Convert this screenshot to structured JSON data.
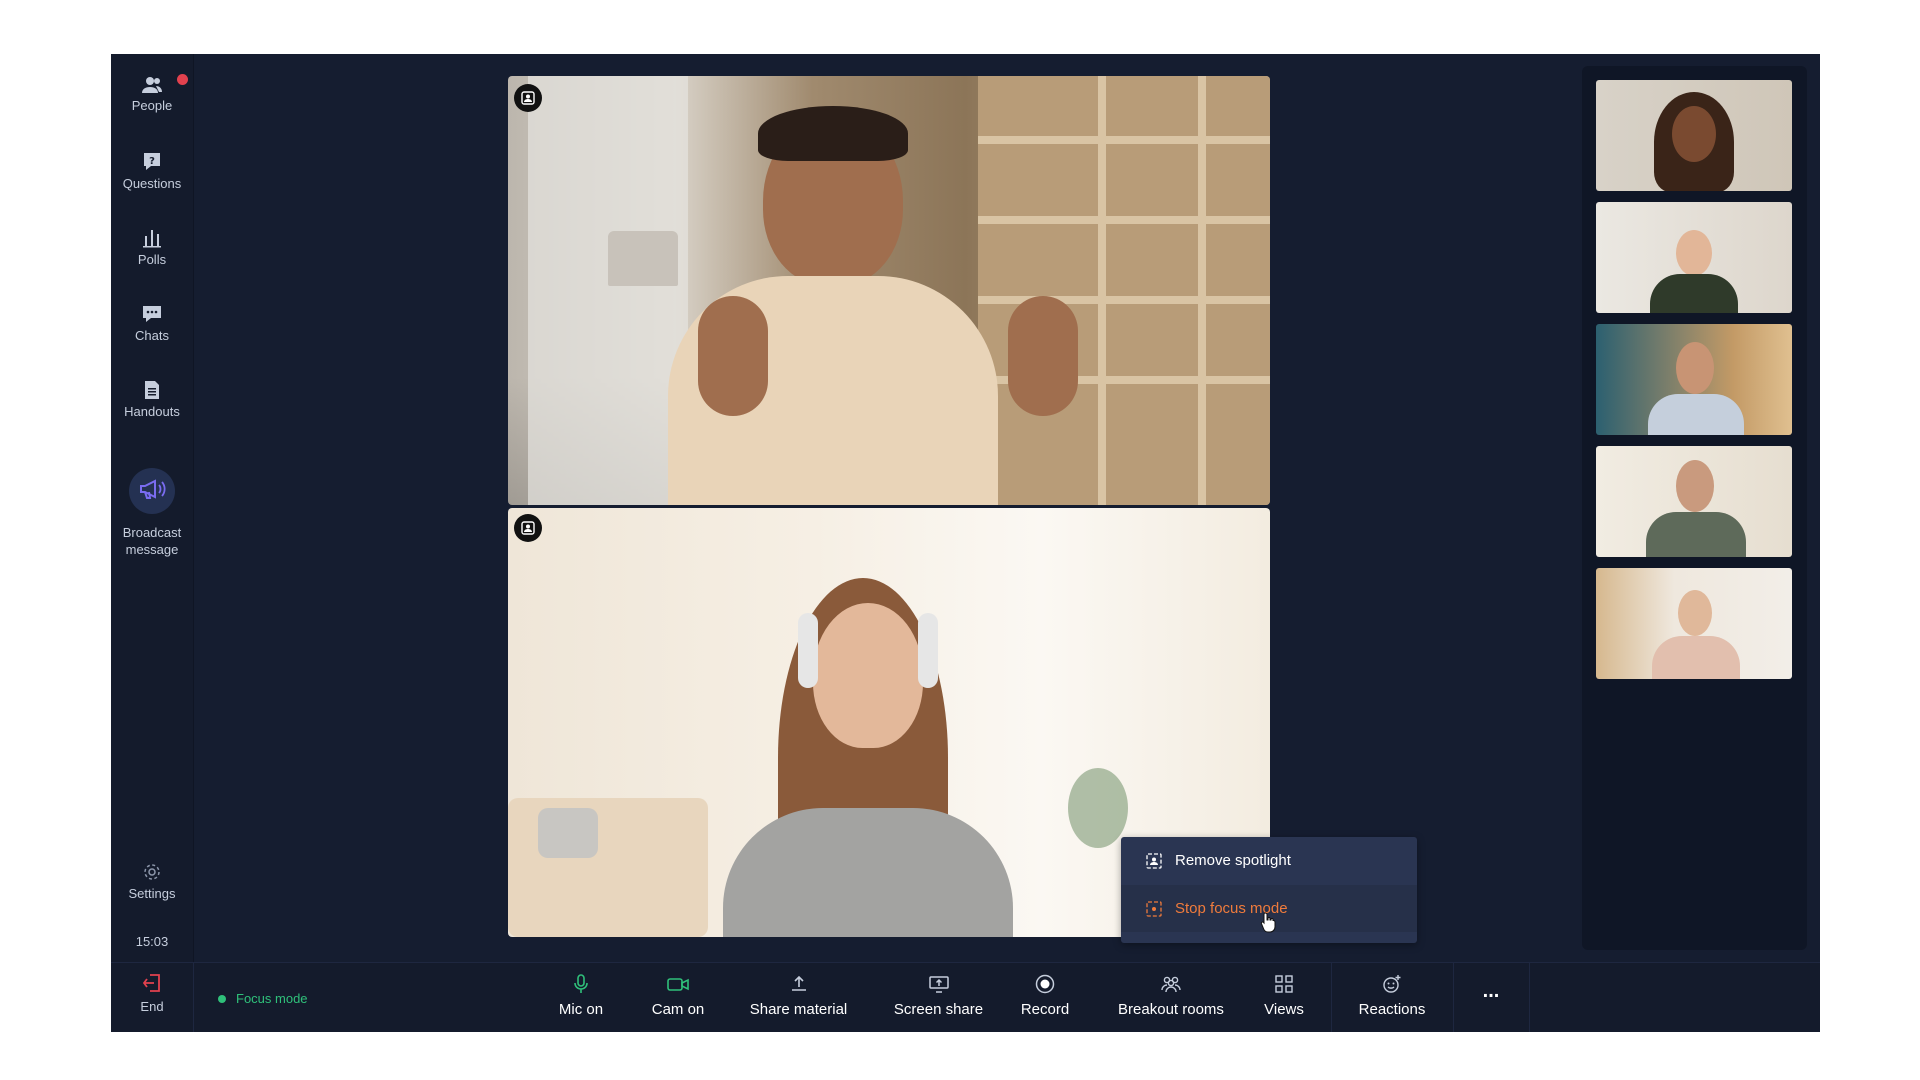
{
  "sidebar": {
    "items": [
      {
        "label": "People",
        "icon": "people-icon"
      },
      {
        "label": "Questions",
        "icon": "question-icon"
      },
      {
        "label": "Polls",
        "icon": "poll-icon"
      },
      {
        "label": "Chats",
        "icon": "chat-icon"
      },
      {
        "label": "Handouts",
        "icon": "document-icon"
      }
    ],
    "broadcast_label": "Broadcast message",
    "settings_label": "Settings",
    "clock": "15:03"
  },
  "menu": {
    "remove_spotlight": "Remove spotlight",
    "stop_focus_mode": "Stop focus mode"
  },
  "bottombar": {
    "end_label": "End",
    "focus_mode": "Focus mode",
    "buttons": [
      {
        "label": "Mic on",
        "icon": "mic-icon"
      },
      {
        "label": "Cam on",
        "icon": "camera-icon"
      },
      {
        "label": "Share material",
        "icon": "share-icon"
      },
      {
        "label": "Screen share",
        "icon": "screen-share-icon"
      },
      {
        "label": "Record",
        "icon": "record-icon"
      },
      {
        "label": "Breakout rooms",
        "icon": "breakout-icon"
      },
      {
        "label": "Views",
        "icon": "grid-icon"
      },
      {
        "label": "Reactions",
        "icon": "reactions-icon"
      }
    ],
    "more_label": "..."
  },
  "colors": {
    "background": "#151d30",
    "accent_green": "#2fc07a",
    "accent_orange": "#ef7b3c",
    "end_red": "#e2414e",
    "broadcast_purple": "#7a6cf0"
  }
}
